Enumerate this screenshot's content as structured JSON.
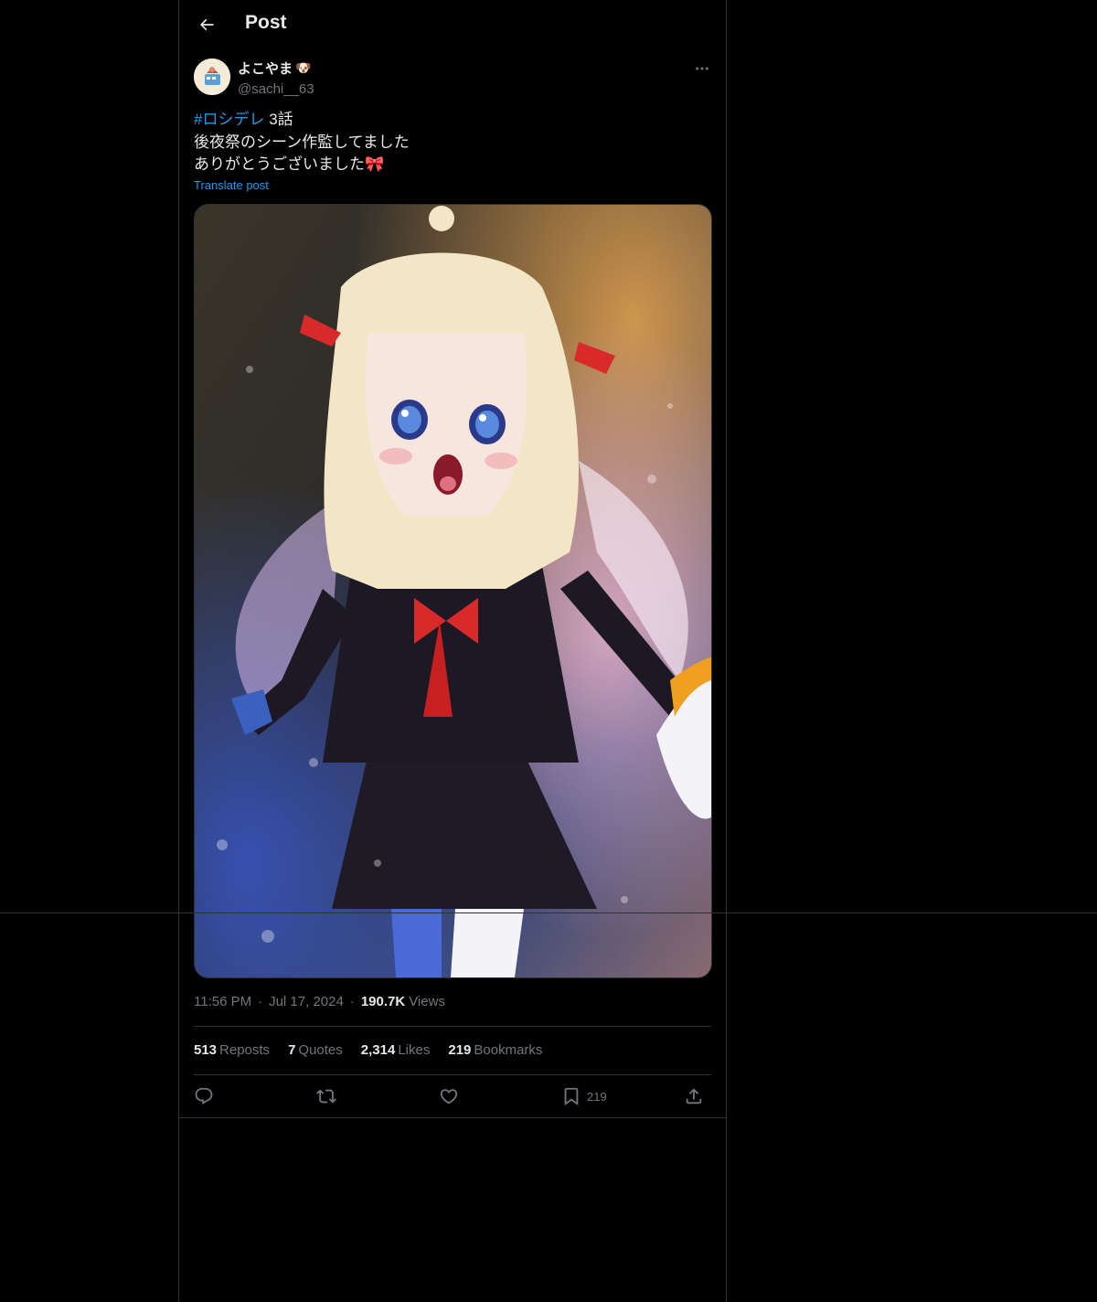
{
  "header": {
    "title": "Post",
    "back_icon": "arrow-left-icon"
  },
  "author": {
    "display_name": "よこやま",
    "name_emoji": "🐶",
    "handle": "@sachi__63"
  },
  "post": {
    "hashtag": "#ロシデレ",
    "line1_rest": " 3話",
    "line2": "後夜祭のシーン作監してました",
    "line3": "ありがとうございました",
    "line3_emoji": "🎀",
    "translate": "Translate post"
  },
  "meta": {
    "time": "11:56 PM",
    "separator": "·",
    "date": "Jul 17, 2024",
    "views_count": "190.7K",
    "views_label": "Views"
  },
  "stats": [
    {
      "count": "513",
      "label": "Reposts"
    },
    {
      "count": "7",
      "label": "Quotes"
    },
    {
      "count": "2,314",
      "label": "Likes"
    },
    {
      "count": "219",
      "label": "Bookmarks"
    }
  ],
  "actions": {
    "reply": "",
    "repost": "",
    "like": "",
    "bookmark_count": "219",
    "share": ""
  },
  "colors": {
    "accent": "#1d9bf0",
    "secondary_text": "#71767b",
    "border": "#2f3336",
    "background": "#000000"
  }
}
